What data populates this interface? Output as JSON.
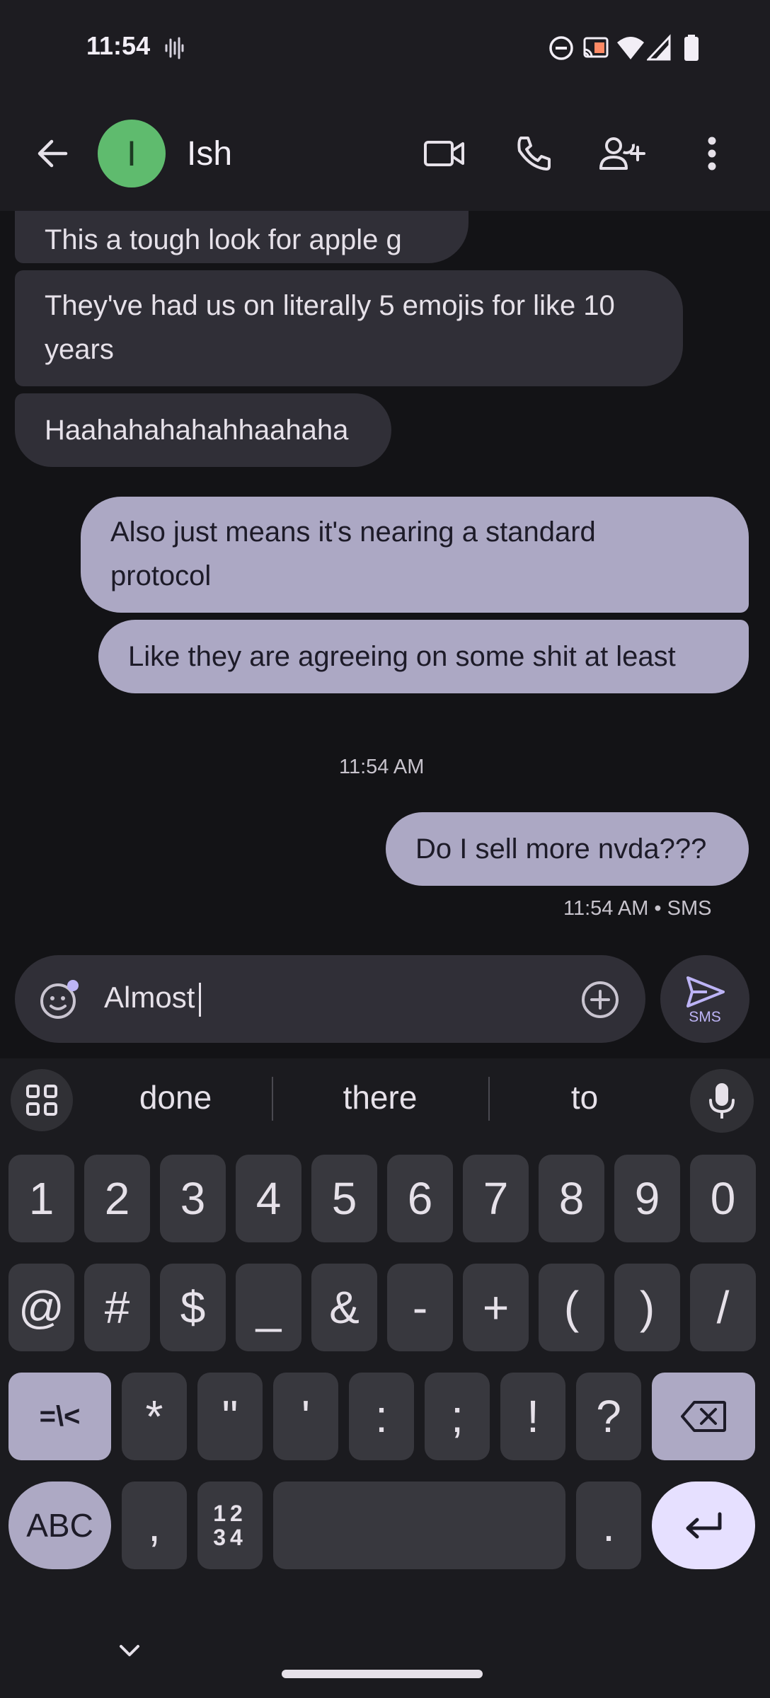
{
  "status_bar": {
    "time": "11:54",
    "icons": [
      "sound-wave-icon",
      "do-not-disturb-icon",
      "cast-icon",
      "wifi-icon",
      "signal-icon",
      "battery-icon"
    ]
  },
  "header": {
    "avatar_initial": "I",
    "contact_name": "Ish",
    "avatar_color": "#5fbb6e",
    "actions": [
      "back-icon",
      "video-call-icon",
      "phone-icon",
      "add-person-icon",
      "more-vert-icon"
    ]
  },
  "messages": [
    {
      "direction": "incoming",
      "text": "This a tough look for apple g"
    },
    {
      "direction": "incoming",
      "text": "They've had us on literally 5 emojis for like 10 years"
    },
    {
      "direction": "incoming",
      "text": "Haahahahahahhaahaha"
    },
    {
      "direction": "outgoing",
      "text": "Also just means it's nearing a standard protocol"
    },
    {
      "direction": "outgoing",
      "text": "Like they are agreeing on some shit at least"
    },
    {
      "direction": "outgoing",
      "text": "Do I sell more nvda???"
    }
  ],
  "timestamps": {
    "divider": "11:54 AM",
    "last_message_status": "11:54 AM • SMS"
  },
  "compose": {
    "text": "Almost",
    "send_label": "SMS"
  },
  "keyboard": {
    "suggestions": [
      "done",
      "there",
      "to"
    ],
    "row1": [
      "1",
      "2",
      "3",
      "4",
      "5",
      "6",
      "7",
      "8",
      "9",
      "0"
    ],
    "row2": [
      "@",
      "#",
      "$",
      "_",
      "&",
      "-",
      "+",
      "(",
      ")",
      "/"
    ],
    "row3": [
      "=\\<",
      "*",
      "\"",
      "'",
      ":",
      ";",
      "!",
      "?"
    ],
    "row4": {
      "abc": "ABC",
      "comma": ",",
      "nums_top": "12",
      "nums_bottom": "34",
      "period": "."
    }
  },
  "colors": {
    "incoming_bubble": "#302f37",
    "outgoing_bubble": "#aca8c4",
    "enter_key": "#e6e0ff",
    "send_accent": "#bdb4f6"
  }
}
